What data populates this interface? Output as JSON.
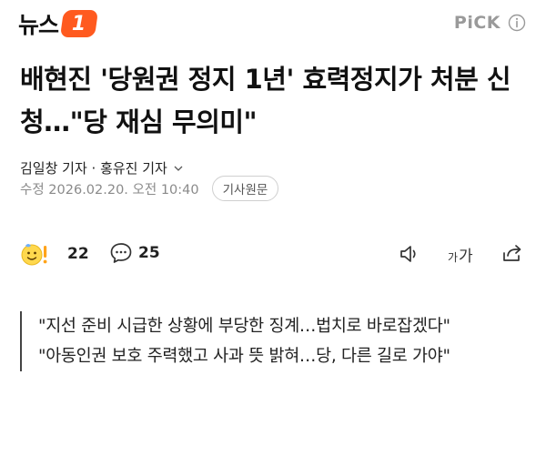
{
  "header": {
    "logo_text": "뉴스",
    "logo_mark": "1",
    "pick_label": "PiCK",
    "info_icon": "info-icon"
  },
  "article": {
    "title": "배현진 '당원권 정지 1년' 효력정지가 처분 신청…\"당 재심 무의미\"",
    "byline": "김일창 기자 · 홍유진 기자",
    "date": "수정 2026.02.20. 오전 10:40",
    "original_button": "기사원문",
    "reaction_count": "22",
    "comment_count": "25",
    "font_size_small": "가",
    "font_size_big": "가",
    "quotes": [
      "\"지선 준비 시급한 상황에 부당한 징계…법치로 바로잡겠다\"",
      "\"아동인권 보호 주력했고 사과 뜻 밝혀…당, 다른 길로 가야\""
    ]
  },
  "colors": {
    "brand": "#ff5a1f",
    "muted": "#8a8a8a",
    "pick": "#9a9a9a"
  }
}
